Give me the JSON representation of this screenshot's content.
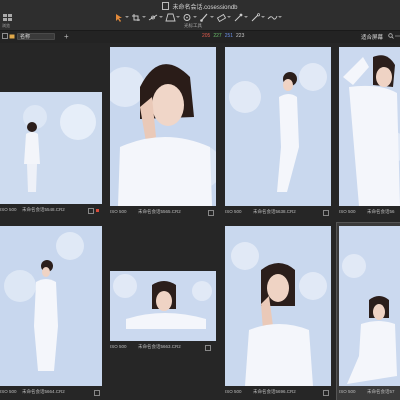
{
  "window": {
    "title": "未命名会话.cosessiondb"
  },
  "toolbar": {
    "left_tool_label": "浏览",
    "tools_label": "光标工具",
    "tools": [
      "pan-icon",
      "crop-icon",
      "straighten-icon",
      "keystone-icon",
      "spot-icon",
      "brush-icon",
      "eraser-icon",
      "picker-icon",
      "gradient-icon",
      "annotate-icon"
    ]
  },
  "filterbar": {
    "sort_value": "名称",
    "add_label": "+",
    "rgb": {
      "r": "205",
      "g": "227",
      "b": "251",
      "l": "223"
    },
    "r_color": "#e05a4c",
    "g_color": "#6cc06c",
    "b_color": "#6a8fe6",
    "l_color": "#c9c9c9",
    "fit_label": "适合屏幕"
  },
  "thumbnails": [
    {
      "iso": "ISO 500",
      "filename": "未命名会话5548.CR2",
      "flagged": true
    },
    {
      "iso": "ISO 500",
      "filename": "未命名会话5565.CR2",
      "flagged": false
    },
    {
      "iso": "ISO 500",
      "filename": "未命名会话5638.CR2",
      "flagged": false
    },
    {
      "iso": "ISO 500",
      "filename": "未命名会话56",
      "flagged": false
    },
    {
      "iso": "ISO 500",
      "filename": "未命名会话5664.CR2",
      "flagged": false
    },
    {
      "iso": "ISO 500",
      "filename": "未命名会话5663.CR2",
      "flagged": false
    },
    {
      "iso": "ISO 500",
      "filename": "未命名会话5696.CR2",
      "flagged": false
    },
    {
      "iso": "ISO 500",
      "filename": "未命名会话57",
      "flagged": false
    }
  ],
  "colors": {
    "background": "#262626",
    "toolbar": "#2e2e2e",
    "photo_bg": "#cfdcef"
  }
}
